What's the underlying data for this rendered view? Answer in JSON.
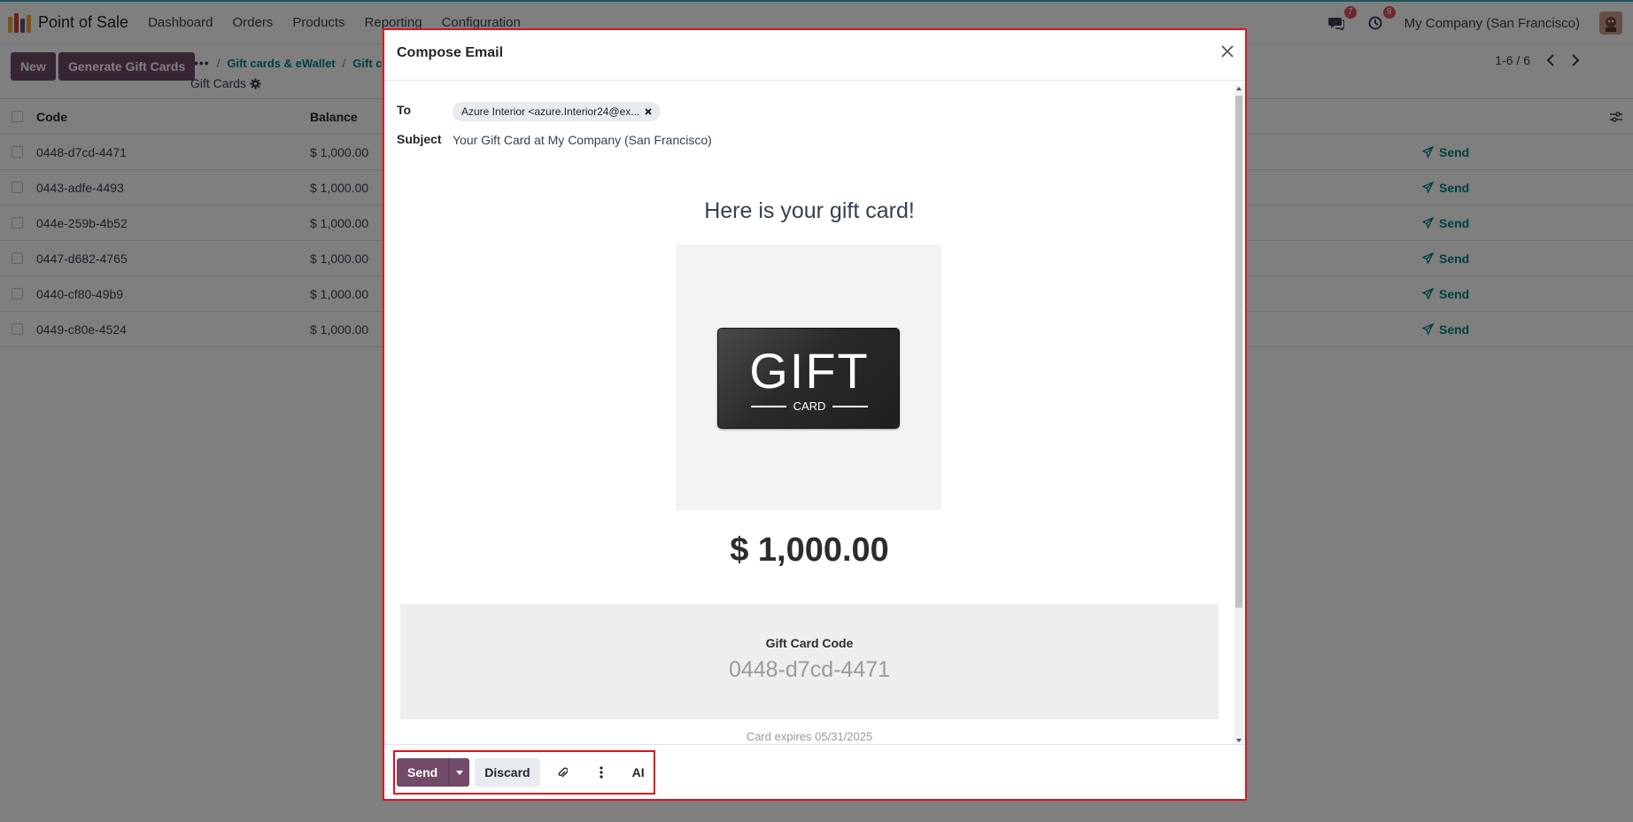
{
  "topbar": {
    "app_name": "Point of Sale",
    "menu": [
      "Dashboard",
      "Orders",
      "Products",
      "Reporting",
      "Configuration"
    ],
    "messages_count": "7",
    "activities_count": "9",
    "company": "My Company (San Francisco)"
  },
  "control_panel": {
    "new_label": "New",
    "generate_label": "Generate Gift Cards",
    "breadcrumb": [
      "Gift cards & eWallet",
      "Gift ca"
    ],
    "current_page": "Gift Cards",
    "pager": "1-6 / 6"
  },
  "list": {
    "columns": [
      "Code",
      "Balance"
    ],
    "send_label": "Send",
    "rows": [
      {
        "code": "0448-d7cd-4471",
        "balance": "$ 1,000.00"
      },
      {
        "code": "0443-adfe-4493",
        "balance": "$ 1,000.00"
      },
      {
        "code": "044e-259b-4b52",
        "balance": "$ 1,000.00"
      },
      {
        "code": "0447-d682-4765",
        "balance": "$ 1,000.00"
      },
      {
        "code": "0440-cf80-49b9",
        "balance": "$ 1,000.00"
      },
      {
        "code": "0449-c80e-4524",
        "balance": "$ 1,000.00"
      }
    ]
  },
  "modal": {
    "title": "Compose Email",
    "to_label": "To",
    "to_tag": "Azure Interior <azure.Interior24@ex...",
    "subject_label": "Subject",
    "subject_value": "Your Gift Card at My Company (San Francisco)",
    "greeting": "Here is your gift card!",
    "card_big_text": "GIFT",
    "card_small_text": "CARD",
    "amount": "$ 1,000.00",
    "code_label": "Gift Card Code",
    "code_value": "0448-d7cd-4471",
    "expires": "Card expires 05/31/2025",
    "footer": {
      "send_label": "Send",
      "discard_label": "Discard",
      "ai_label": "AI"
    }
  },
  "colors": {
    "primary": "#714b67",
    "link": "#017e84",
    "highlight_border": "#e3101f"
  }
}
